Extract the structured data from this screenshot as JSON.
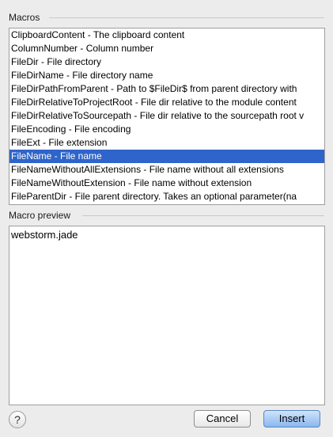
{
  "macros_label": "Macros",
  "macro_preview_label": "Macro preview",
  "macros": [
    {
      "text": "ClipboardContent - The clipboard content",
      "selected": false
    },
    {
      "text": "ColumnNumber - Column number",
      "selected": false
    },
    {
      "text": "FileDir - File directory",
      "selected": false
    },
    {
      "text": "FileDirName - File directory name",
      "selected": false
    },
    {
      "text": "FileDirPathFromParent - Path to $FileDir$ from parent directory with",
      "selected": false
    },
    {
      "text": "FileDirRelativeToProjectRoot - File dir relative to the module content",
      "selected": false
    },
    {
      "text": "FileDirRelativeToSourcepath - File dir relative to the sourcepath root v",
      "selected": false
    },
    {
      "text": "FileEncoding - File encoding",
      "selected": false
    },
    {
      "text": "FileExt - File extension",
      "selected": false
    },
    {
      "text": "FileName - File name",
      "selected": true
    },
    {
      "text": "FileNameWithoutAllExtensions - File name without all extensions",
      "selected": false
    },
    {
      "text": "FileNameWithoutExtension - File name without extension",
      "selected": false
    },
    {
      "text": "FileParentDir - File parent directory. Takes an optional parameter(na",
      "selected": false
    }
  ],
  "preview_text": "webstorm.jade",
  "help_label": "?",
  "cancel_label": "Cancel",
  "insert_label": "Insert",
  "colors": {
    "selection": "#2f65ca",
    "background": "#ececec"
  }
}
